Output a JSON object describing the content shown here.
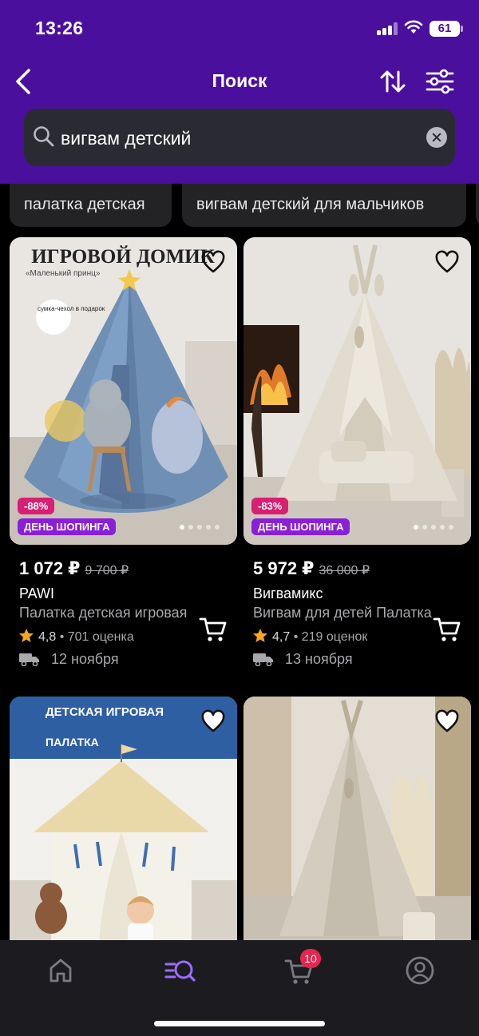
{
  "status_bar": {
    "time": "13:26",
    "battery": "61"
  },
  "header": {
    "title": "Поиск"
  },
  "search": {
    "query": "вигвам детский"
  },
  "chips": [
    {
      "label": "палатка детская"
    },
    {
      "label": "вигвам детский для мальчиков"
    }
  ],
  "products": [
    {
      "image_caption_1": "ИГРОВОЙ ДОМИК",
      "image_caption_2": "«Маленький принц»",
      "image_caption_3": "сумка-чехол в подарок",
      "discount": "-88%",
      "promo": "ДЕНЬ ШОПИНГА",
      "price": "1 072 ₽",
      "old_price": "9 700 ₽",
      "brand": "PAWI",
      "name": "Палатка детская игровая",
      "rating": "4,8",
      "reviews": "701 оценка",
      "delivery": "12 ноября"
    },
    {
      "discount": "-83%",
      "promo": "ДЕНЬ ШОПИНГА",
      "price": "5 972 ₽",
      "old_price": "36 000 ₽",
      "brand": "Вигвамикс",
      "name": "Вигвам для детей Палатка",
      "rating": "4,7",
      "reviews": "219 оценок",
      "delivery": "13 ноября"
    },
    {
      "image_caption_1": "ДЕТСКАЯ ИГРОВАЯ",
      "image_caption_2": "ПАЛАТКА"
    },
    {}
  ],
  "tabbar": {
    "cart_badge": "10"
  },
  "colors": {
    "header": "#4b0f9e",
    "accent": "#9b6bff",
    "discount": "#d81f73",
    "promo": "#8a1fd8"
  }
}
